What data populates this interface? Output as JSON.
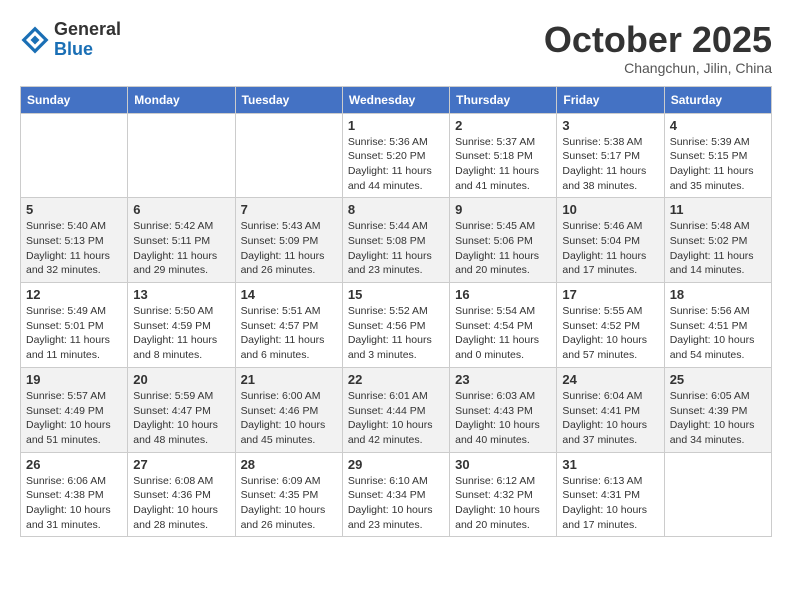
{
  "header": {
    "logo": {
      "general": "General",
      "blue": "Blue"
    },
    "month": "October 2025",
    "location": "Changchun, Jilin, China"
  },
  "weekdays": [
    "Sunday",
    "Monday",
    "Tuesday",
    "Wednesday",
    "Thursday",
    "Friday",
    "Saturday"
  ],
  "weeks": [
    [
      {
        "day": "",
        "info": ""
      },
      {
        "day": "",
        "info": ""
      },
      {
        "day": "",
        "info": ""
      },
      {
        "day": "1",
        "info": "Sunrise: 5:36 AM\nSunset: 5:20 PM\nDaylight: 11 hours and 44 minutes."
      },
      {
        "day": "2",
        "info": "Sunrise: 5:37 AM\nSunset: 5:18 PM\nDaylight: 11 hours and 41 minutes."
      },
      {
        "day": "3",
        "info": "Sunrise: 5:38 AM\nSunset: 5:17 PM\nDaylight: 11 hours and 38 minutes."
      },
      {
        "day": "4",
        "info": "Sunrise: 5:39 AM\nSunset: 5:15 PM\nDaylight: 11 hours and 35 minutes."
      }
    ],
    [
      {
        "day": "5",
        "info": "Sunrise: 5:40 AM\nSunset: 5:13 PM\nDaylight: 11 hours and 32 minutes."
      },
      {
        "day": "6",
        "info": "Sunrise: 5:42 AM\nSunset: 5:11 PM\nDaylight: 11 hours and 29 minutes."
      },
      {
        "day": "7",
        "info": "Sunrise: 5:43 AM\nSunset: 5:09 PM\nDaylight: 11 hours and 26 minutes."
      },
      {
        "day": "8",
        "info": "Sunrise: 5:44 AM\nSunset: 5:08 PM\nDaylight: 11 hours and 23 minutes."
      },
      {
        "day": "9",
        "info": "Sunrise: 5:45 AM\nSunset: 5:06 PM\nDaylight: 11 hours and 20 minutes."
      },
      {
        "day": "10",
        "info": "Sunrise: 5:46 AM\nSunset: 5:04 PM\nDaylight: 11 hours and 17 minutes."
      },
      {
        "day": "11",
        "info": "Sunrise: 5:48 AM\nSunset: 5:02 PM\nDaylight: 11 hours and 14 minutes."
      }
    ],
    [
      {
        "day": "12",
        "info": "Sunrise: 5:49 AM\nSunset: 5:01 PM\nDaylight: 11 hours and 11 minutes."
      },
      {
        "day": "13",
        "info": "Sunrise: 5:50 AM\nSunset: 4:59 PM\nDaylight: 11 hours and 8 minutes."
      },
      {
        "day": "14",
        "info": "Sunrise: 5:51 AM\nSunset: 4:57 PM\nDaylight: 11 hours and 6 minutes."
      },
      {
        "day": "15",
        "info": "Sunrise: 5:52 AM\nSunset: 4:56 PM\nDaylight: 11 hours and 3 minutes."
      },
      {
        "day": "16",
        "info": "Sunrise: 5:54 AM\nSunset: 4:54 PM\nDaylight: 11 hours and 0 minutes."
      },
      {
        "day": "17",
        "info": "Sunrise: 5:55 AM\nSunset: 4:52 PM\nDaylight: 10 hours and 57 minutes."
      },
      {
        "day": "18",
        "info": "Sunrise: 5:56 AM\nSunset: 4:51 PM\nDaylight: 10 hours and 54 minutes."
      }
    ],
    [
      {
        "day": "19",
        "info": "Sunrise: 5:57 AM\nSunset: 4:49 PM\nDaylight: 10 hours and 51 minutes."
      },
      {
        "day": "20",
        "info": "Sunrise: 5:59 AM\nSunset: 4:47 PM\nDaylight: 10 hours and 48 minutes."
      },
      {
        "day": "21",
        "info": "Sunrise: 6:00 AM\nSunset: 4:46 PM\nDaylight: 10 hours and 45 minutes."
      },
      {
        "day": "22",
        "info": "Sunrise: 6:01 AM\nSunset: 4:44 PM\nDaylight: 10 hours and 42 minutes."
      },
      {
        "day": "23",
        "info": "Sunrise: 6:03 AM\nSunset: 4:43 PM\nDaylight: 10 hours and 40 minutes."
      },
      {
        "day": "24",
        "info": "Sunrise: 6:04 AM\nSunset: 4:41 PM\nDaylight: 10 hours and 37 minutes."
      },
      {
        "day": "25",
        "info": "Sunrise: 6:05 AM\nSunset: 4:39 PM\nDaylight: 10 hours and 34 minutes."
      }
    ],
    [
      {
        "day": "26",
        "info": "Sunrise: 6:06 AM\nSunset: 4:38 PM\nDaylight: 10 hours and 31 minutes."
      },
      {
        "day": "27",
        "info": "Sunrise: 6:08 AM\nSunset: 4:36 PM\nDaylight: 10 hours and 28 minutes."
      },
      {
        "day": "28",
        "info": "Sunrise: 6:09 AM\nSunset: 4:35 PM\nDaylight: 10 hours and 26 minutes."
      },
      {
        "day": "29",
        "info": "Sunrise: 6:10 AM\nSunset: 4:34 PM\nDaylight: 10 hours and 23 minutes."
      },
      {
        "day": "30",
        "info": "Sunrise: 6:12 AM\nSunset: 4:32 PM\nDaylight: 10 hours and 20 minutes."
      },
      {
        "day": "31",
        "info": "Sunrise: 6:13 AM\nSunset: 4:31 PM\nDaylight: 10 hours and 17 minutes."
      },
      {
        "day": "",
        "info": ""
      }
    ]
  ]
}
